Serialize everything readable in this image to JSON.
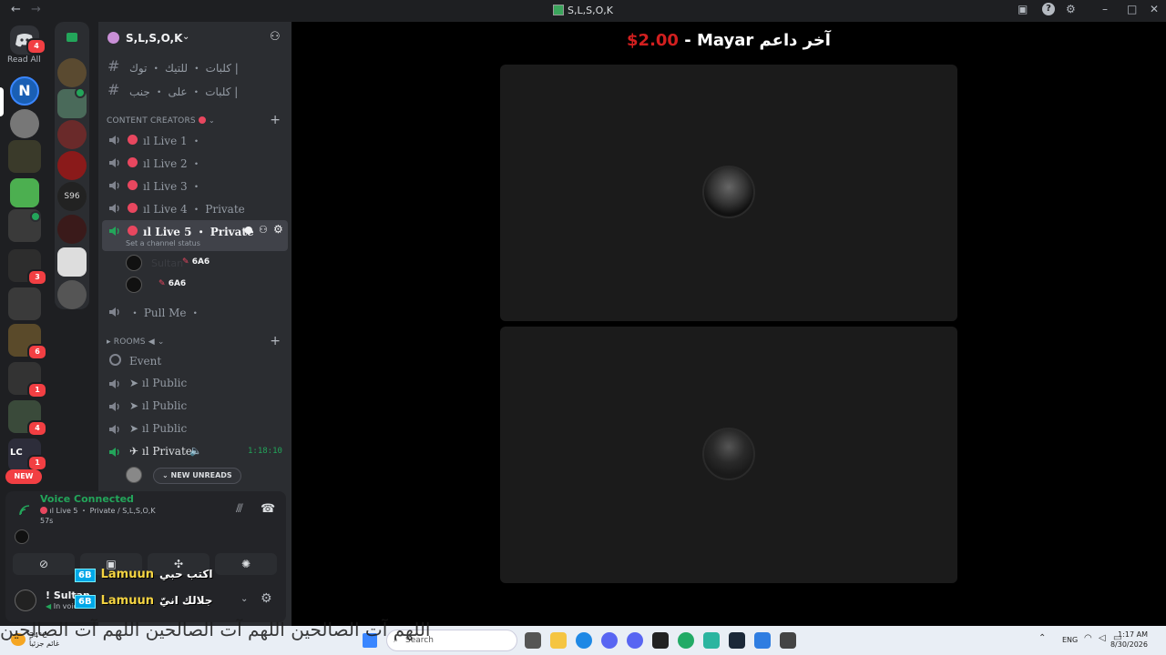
{
  "window": {
    "title": "S,L,S,O,K",
    "back": "←",
    "forward": "→"
  },
  "guilds": {
    "read_all": "Read All",
    "home_badge": "4",
    "new_label": "NEW",
    "badges": [
      "3",
      "6",
      "1",
      "4",
      "1"
    ]
  },
  "server": {
    "name": "S,L,S,O,K",
    "text_channels": [
      "كلبات ・ للتيك ・ توك |",
      "كلبات ・ على ・ جنب |"
    ],
    "categories": {
      "content_creators": "CONTENT CREATORS",
      "rooms": "ROOMS"
    },
    "voice_channels": [
      {
        "label": "ıl Live 1 ・"
      },
      {
        "label": "ıl Live 2 ・"
      },
      {
        "label": "ıl Live 3 ・"
      },
      {
        "label": "ıl Live 4 ・ Private"
      },
      {
        "label": "ıl Live 5 ・ Private"
      }
    ],
    "channel_status_hint": "Set a channel status",
    "members": [
      {
        "name": "Sultan",
        "tag": "6A6"
      },
      {
        "name": "",
        "tag": "6A6"
      }
    ],
    "pull_me": "・ Pull Me ・",
    "rooms": [
      {
        "label": "Event"
      },
      {
        "label": "➤ ıl Public"
      },
      {
        "label": "➤ ıl Public"
      },
      {
        "label": "➤ ıl Public"
      },
      {
        "label": "✈ ıl Private"
      }
    ],
    "private_timer": "1:18:10",
    "new_unreads": "NEW UNREADS"
  },
  "voice_panel": {
    "status": "Voice Connected",
    "channel": "ıl Live 5 ・ Private / S,L,S,O,K",
    "elapsed": "57s"
  },
  "user": {
    "name": "! Sultan",
    "status": "In voice"
  },
  "overlay": {
    "lines": [
      {
        "badge": "6B",
        "name": "Lamuun",
        "message": "اكتب حبي"
      },
      {
        "badge": "6B",
        "name": "Lamuun",
        "message": "جلالك انيّ"
      }
    ]
  },
  "stage": {
    "donor_prefix": "آخر داعم",
    "donor_name": "Mayar",
    "donor_amount": "$2.00",
    "separator": "-"
  },
  "taskbar": {
    "temperature": "34°C",
    "weather_desc": "غائم جزئياً",
    "search_placeholder": "Search",
    "lang": "ENG",
    "time": "1:17 AM",
    "date": "8/30/2026"
  },
  "background_text": {
    "line1": "اللهم آت الصالحين   اللهم آت الصالحين   اللهم آت الصالحين"
  },
  "colors": {
    "discord_dark": "#1e1f22",
    "sidebar": "#2b2d31",
    "voice_green": "#23a55a",
    "live_dot": "#e8475f",
    "donor_red": "#d21f1f"
  }
}
